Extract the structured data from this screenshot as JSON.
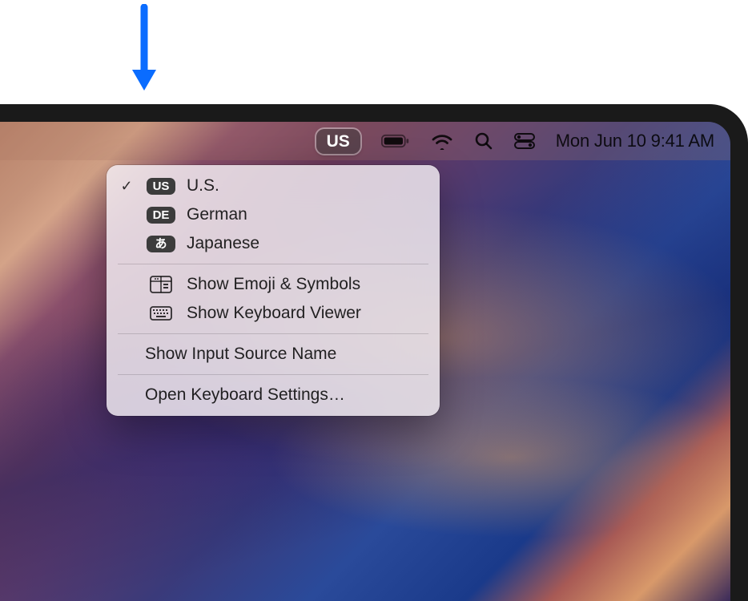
{
  "menubar": {
    "input_source_badge": "US",
    "datetime": "Mon Jun 10  9:41 AM"
  },
  "input_menu": {
    "sources": [
      {
        "badge": "US",
        "label": "U.S.",
        "selected": true
      },
      {
        "badge": "DE",
        "label": "German",
        "selected": false
      },
      {
        "badge": "あ",
        "label": "Japanese",
        "selected": false
      }
    ],
    "actions": {
      "emoji": "Show Emoji & Symbols",
      "keyboard_viewer": "Show Keyboard Viewer",
      "show_name": "Show Input Source Name",
      "open_settings": "Open Keyboard Settings…"
    }
  }
}
